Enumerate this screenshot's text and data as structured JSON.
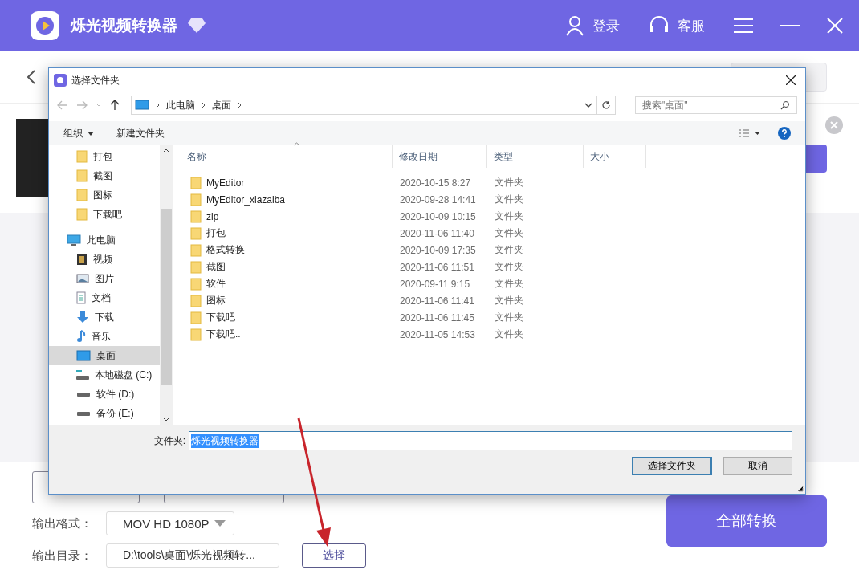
{
  "app": {
    "title": "烁光视频转换器",
    "login": "登录",
    "service": "客服",
    "output_format_label": "输出格式：",
    "output_format": "MOV HD 1080P",
    "output_dir_label": "输出目录：",
    "output_dir": "D:\\tools\\桌面\\烁光视频转...",
    "choose_button": "选择",
    "convert_all_button": "全部转换"
  },
  "dialog": {
    "title": "选择文件夹",
    "breadcrumb": [
      "此电脑",
      "桌面"
    ],
    "search": {
      "placeholder": "搜索\"桌面\""
    },
    "toolbar": {
      "organize": "组织",
      "new_folder": "新建文件夹"
    },
    "nav": {
      "items": [
        {
          "label": "打包",
          "kind": "folder",
          "selected": false
        },
        {
          "label": "截图",
          "kind": "folder",
          "selected": false
        },
        {
          "label": "图标",
          "kind": "folder",
          "selected": false
        },
        {
          "label": "下载吧",
          "kind": "folder",
          "selected": false
        },
        {
          "label": "此电脑",
          "kind": "pc",
          "selected": false,
          "children": [
            {
              "label": "视频",
              "kind": "video",
              "selected": false
            },
            {
              "label": "图片",
              "kind": "picture",
              "selected": false
            },
            {
              "label": "文档",
              "kind": "document",
              "selected": false
            },
            {
              "label": "下载",
              "kind": "download",
              "selected": false
            },
            {
              "label": "音乐",
              "kind": "music",
              "selected": false
            },
            {
              "label": "桌面",
              "kind": "desktop",
              "selected": true
            },
            {
              "label": "本地磁盘 (C:)",
              "kind": "system-drive",
              "selected": false
            },
            {
              "label": "软件 (D:)",
              "kind": "drive",
              "selected": false
            },
            {
              "label": "备份 (E:)",
              "kind": "drive",
              "selected": false
            }
          ]
        }
      ]
    },
    "table": {
      "columns": [
        "名称",
        "修改日期",
        "类型",
        "大小"
      ],
      "rows": [
        {
          "name": "MyEditor",
          "date": "2020-10-15 8:27",
          "type": "文件夹"
        },
        {
          "name": "MyEditor_xiazaiba",
          "date": "2020-09-28 14:41",
          "type": "文件夹"
        },
        {
          "name": "zip",
          "date": "2020-10-09 10:15",
          "type": "文件夹"
        },
        {
          "name": "打包",
          "date": "2020-11-06 11:40",
          "type": "文件夹"
        },
        {
          "name": "格式转换",
          "date": "2020-10-09 17:35",
          "type": "文件夹"
        },
        {
          "name": "截图",
          "date": "2020-11-06 11:51",
          "type": "文件夹"
        },
        {
          "name": "软件",
          "date": "2020-09-11 9:15",
          "type": "文件夹"
        },
        {
          "name": "图标",
          "date": "2020-11-06 11:41",
          "type": "文件夹"
        },
        {
          "name": "下载吧",
          "date": "2020-11-06 11:45",
          "type": "文件夹"
        },
        {
          "name": "下载吧..",
          "date": "2020-11-05 14:53",
          "type": "文件夹"
        }
      ]
    },
    "folder_label": "文件夹:",
    "folder_value": "烁光视频转换器",
    "folder_value_selected": true,
    "buttons": [
      "选择文件夹",
      "取消"
    ]
  }
}
